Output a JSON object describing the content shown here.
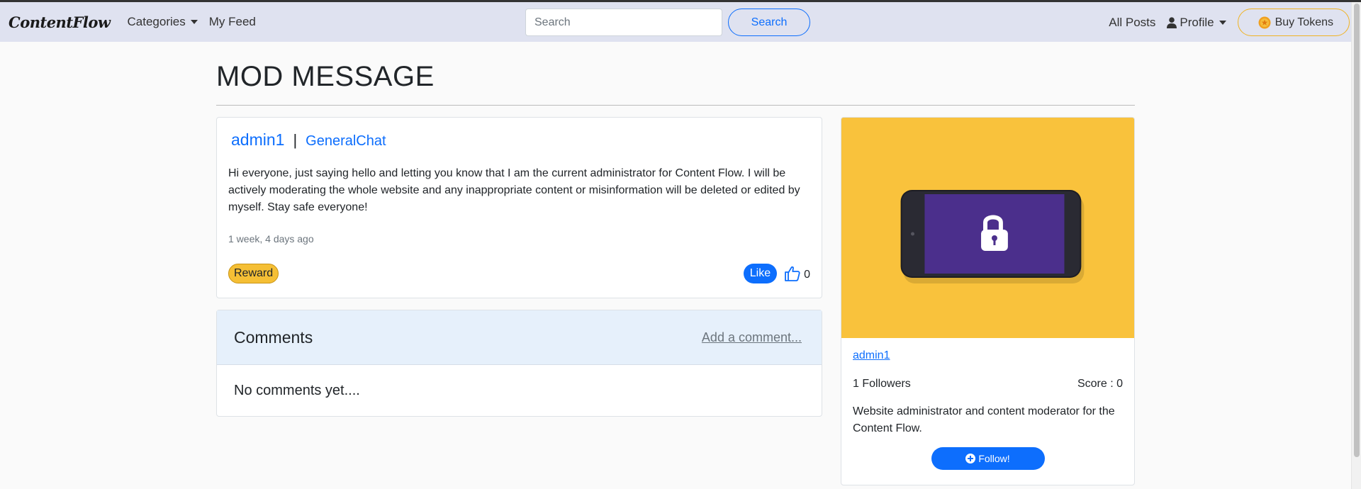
{
  "navbar": {
    "brand": "ContentFlow",
    "categories_label": "Categories",
    "my_feed_label": "My Feed",
    "search_placeholder": "Search",
    "search_button": "Search",
    "all_posts_label": "All Posts",
    "profile_label": "Profile",
    "buy_tokens_label": "Buy Tokens"
  },
  "page": {
    "title": "MOD MESSAGE"
  },
  "post": {
    "author": "admin1",
    "separator": "|",
    "category": "GeneralChat",
    "body": "Hi everyone, just saying hello and letting you know that I am the current administrator for Content Flow. I will be actively moderating the whole website and any inappropriate content or misinformation will be deleted or edited by myself. Stay safe everyone!",
    "time": "1 week, 4 days ago",
    "reward_label": "Reward",
    "like_label": "Like",
    "like_count": "0"
  },
  "comments": {
    "title": "Comments",
    "add_label": "Add a comment...",
    "empty_text": "No comments yet...."
  },
  "profile": {
    "name": "admin1",
    "followers": "1 Followers",
    "score": "Score : 0",
    "bio": "Website administrator and content moderator for the Content Flow.",
    "follow_label": "Follow!"
  },
  "colors": {
    "navbar_bg": "#dfe2f0",
    "primary": "#0d6efd",
    "reward": "#f5bf35",
    "image_bg": "#f9c23c",
    "phone_screen": "#4b2f8c"
  },
  "icons": [
    "caret-down-icon",
    "person-icon",
    "coin-icon",
    "thumbs-up-icon",
    "plus-circle-icon",
    "lock-icon"
  ]
}
